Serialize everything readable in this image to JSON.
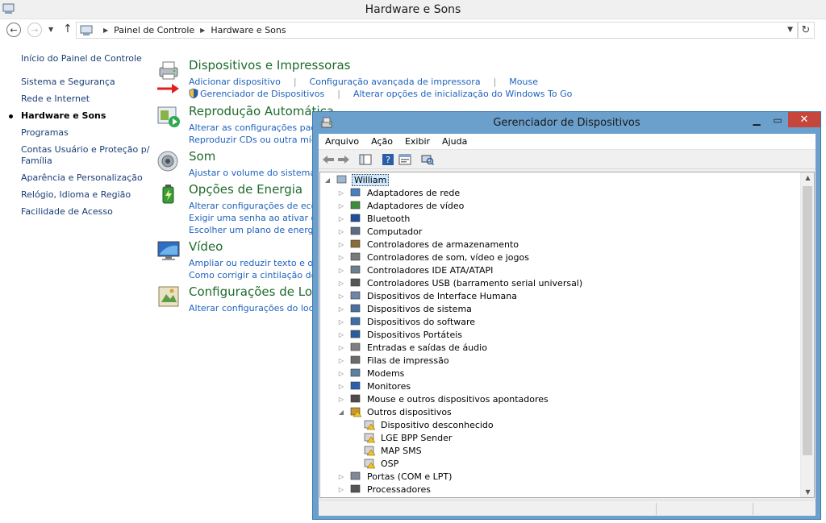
{
  "window": {
    "title": "Hardware e Sons"
  },
  "address": {
    "crumbs": [
      "Painel de Controle",
      "Hardware e Sons"
    ]
  },
  "sidebar": {
    "home": "Início do Painel de Controle",
    "items": [
      "Sistema e Segurança",
      "Rede e Internet",
      "Hardware e Sons",
      "Programas",
      "Contas Usuário e Proteção p/ Família",
      "Aparência e Personalização",
      "Relógio, Idioma e Região",
      "Facilidade de Acesso"
    ],
    "current_index": 2
  },
  "categories": {
    "devices": {
      "title": "Dispositivos e Impressoras",
      "links": [
        "Adicionar dispositivo",
        "Configuração avançada de impressora",
        "Mouse"
      ],
      "links2": [
        "Gerenciador de Dispositivos",
        "Alterar opções de inicialização do Windows To Go"
      ]
    },
    "autoplay": {
      "title": "Reprodução Automática",
      "links": [
        "Alterar as configurações padrão",
        "Reproduzir CDs ou outra mídia a"
      ]
    },
    "sound": {
      "title": "Som",
      "links": [
        "Ajustar o volume do sistema"
      ]
    },
    "power": {
      "title": "Opções de Energia",
      "links": [
        "Alterar configurações de econom",
        "Exigir uma senha ao ativar o com",
        "Escolher um plano de energia"
      ]
    },
    "video": {
      "title": "Vídeo",
      "links": [
        "Ampliar ou reduzir texto e outros",
        "Como corrigir a cintilação do mo"
      ]
    },
    "location": {
      "title": "Configurações de Local",
      "links": [
        "Alterar configurações do local"
      ]
    }
  },
  "device_manager": {
    "title": "Gerenciador de Dispositivos",
    "menu": [
      "Arquivo",
      "Ação",
      "Exibir",
      "Ajuda"
    ],
    "root": "William",
    "nodes": [
      "Adaptadores de rede",
      "Adaptadores de vídeo",
      "Bluetooth",
      "Computador",
      "Controladores de armazenamento",
      "Controladores de som, vídeo e jogos",
      "Controladores IDE ATA/ATAPI",
      "Controladores USB (barramento serial universal)",
      "Dispositivos de Interface Humana",
      "Dispositivos de sistema",
      "Dispositivos do software",
      "Dispositivos Portáteis",
      "Entradas e saídas de áudio",
      "Filas de impressão",
      "Modems",
      "Monitores",
      "Mouse e outros dispositivos apontadores",
      "Outros dispositivos"
    ],
    "other_children": [
      "Dispositivo desconhecido",
      "LGE BPP Sender",
      "MAP SMS",
      "OSP"
    ],
    "nodes_after": [
      "Portas (COM e LPT)",
      "Processadores"
    ]
  },
  "colors": {
    "link": "#1f62bd",
    "category_title": "#1e6b2c",
    "dm_frame": "#6b9fcc",
    "close": "#c7463b"
  }
}
